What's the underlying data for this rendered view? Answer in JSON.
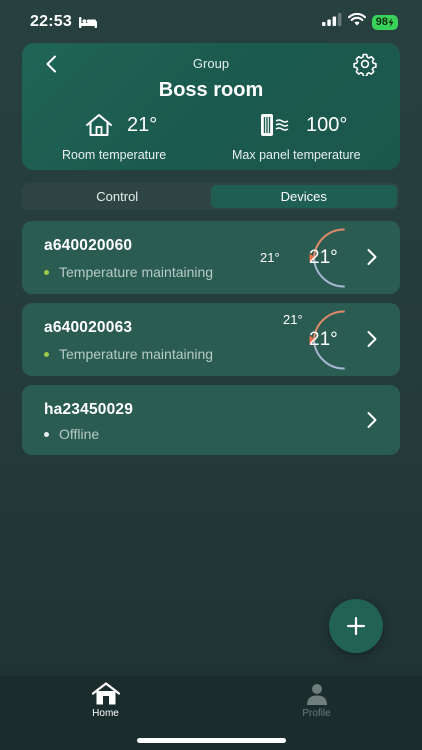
{
  "status_bar": {
    "time": "22:53",
    "battery": "98"
  },
  "header": {
    "group_label": "Group",
    "title": "Boss room",
    "room_temp": {
      "value": "21°",
      "label": "Room temperature"
    },
    "max_panel_temp": {
      "value": "100°",
      "label": "Max panel temperature"
    }
  },
  "tabs": {
    "control": "Control",
    "devices": "Devices",
    "active": "Devices"
  },
  "devices": [
    {
      "name": "a640020060",
      "status": "Temperature maintaining",
      "set_temp": "21°",
      "current_temp": "21°"
    },
    {
      "name": "a640020063",
      "status": "Temperature maintaining",
      "set_temp": "21°",
      "current_temp": "21°"
    },
    {
      "name": "ha23450029",
      "status": "Offline"
    }
  ],
  "tabbar": {
    "home": "Home",
    "profile": "Profile"
  },
  "colors": {
    "accent": "#216255",
    "status_ok": "#9bc94a",
    "status_offline": "#e7eeec",
    "gauge_warm": "#e08a6a",
    "gauge_cool": "#a9b7d6",
    "battery": "#3ad35a"
  },
  "icons": {
    "back": "chevron-left-icon",
    "settings": "gear-icon",
    "room": "house-icon",
    "panel": "heater-panel-icon",
    "chevron": "chevron-right-icon",
    "add": "plus-icon",
    "home": "home-icon",
    "profile": "person-icon"
  }
}
